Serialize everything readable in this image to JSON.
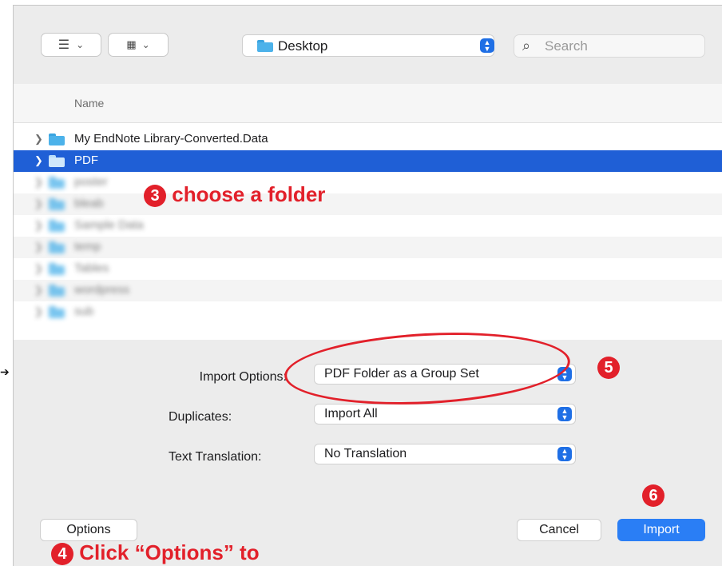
{
  "toolbar": {
    "list_view_icon": "list-icon",
    "grid_view_icon": "grid-icon",
    "location": "Desktop",
    "search_placeholder": "Search"
  },
  "list": {
    "header": "Name",
    "rows": [
      {
        "name": "My EndNote Library-Converted.Data",
        "selected": false
      },
      {
        "name": "PDF",
        "selected": true
      },
      {
        "name": "poster",
        "blurred": true
      },
      {
        "name": "bleab",
        "blurred": true
      },
      {
        "name": "Sample Data",
        "blurred": true
      },
      {
        "name": "temp",
        "blurred": true
      },
      {
        "name": "Tables",
        "blurred": true
      },
      {
        "name": "wordpress",
        "blurred": true
      },
      {
        "name": "sub",
        "blurred": true
      }
    ]
  },
  "options": {
    "import_options_label": "Import Options:",
    "import_options_value": "PDF Folder as a Group Set",
    "duplicates_label": "Duplicates:",
    "duplicates_value": "Import All",
    "text_translation_label": "Text Translation:",
    "text_translation_value": "No Translation"
  },
  "buttons": {
    "options": "Options",
    "cancel": "Cancel",
    "import": "Import"
  },
  "annotations": {
    "step3_num": "3",
    "step3_text": "choose a folder",
    "step4_num": "4",
    "step4_text": "Click “Options” to",
    "step5_num": "5",
    "step6_num": "6"
  },
  "colors": {
    "accent": "#2a7ef5",
    "selection": "#1f5fd6",
    "annotation_red": "#e2202a"
  }
}
